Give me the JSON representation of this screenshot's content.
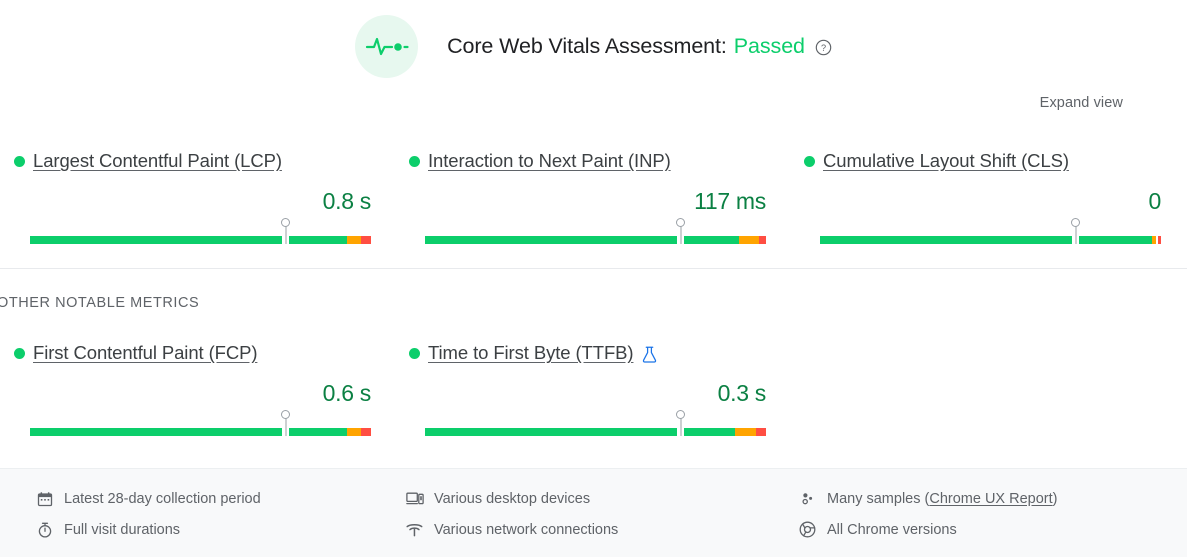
{
  "assessment": {
    "icon": "pulse-icon",
    "label": "Core Web Vitals Assessment:",
    "status": "Passed",
    "status_color": "#0cce6b",
    "help_icon": "help-circle-icon"
  },
  "expand_view": {
    "label": "Expand view"
  },
  "section_label": "OTHER NOTABLE METRICS",
  "colors": {
    "good": "#0cce6b",
    "needs_improvement": "#ffa400",
    "poor": "#ff4e42",
    "value_text": "#0b8043",
    "marker": "#9aa0a6"
  },
  "core_metrics": [
    {
      "name": "Largest Contentful Paint (LCP)",
      "value": "0.8 s",
      "status": "good",
      "marker_percent": 75,
      "distribution": [
        {
          "rating": "good",
          "percent": 74
        },
        {
          "rating": "gap",
          "percent": 2
        },
        {
          "rating": "good",
          "percent": 17
        },
        {
          "rating": "ni",
          "percent": 4
        },
        {
          "rating": "poor",
          "percent": 3
        }
      ]
    },
    {
      "name": "Interaction to Next Paint (INP)",
      "value": "117 ms",
      "status": "good",
      "marker_percent": 75,
      "distribution": [
        {
          "rating": "good",
          "percent": 74
        },
        {
          "rating": "gap",
          "percent": 2
        },
        {
          "rating": "good",
          "percent": 16
        },
        {
          "rating": "ni",
          "percent": 6
        },
        {
          "rating": "poor",
          "percent": 2
        }
      ]
    },
    {
      "name": "Cumulative Layout Shift (CLS)",
      "value": "0",
      "status": "good",
      "marker_percent": 75,
      "distribution": [
        {
          "rating": "good",
          "percent": 74
        },
        {
          "rating": "gap",
          "percent": 2
        },
        {
          "rating": "good",
          "percent": 21.5
        },
        {
          "rating": "ni",
          "percent": 1
        },
        {
          "rating": "gap",
          "percent": 0.5
        },
        {
          "rating": "poor",
          "percent": 1
        }
      ]
    }
  ],
  "other_metrics": [
    {
      "name": "First Contentful Paint (FCP)",
      "value": "0.6 s",
      "status": "good",
      "marker_percent": 75,
      "badge": null,
      "distribution": [
        {
          "rating": "good",
          "percent": 74
        },
        {
          "rating": "gap",
          "percent": 2
        },
        {
          "rating": "good",
          "percent": 17
        },
        {
          "rating": "ni",
          "percent": 4
        },
        {
          "rating": "poor",
          "percent": 3
        }
      ]
    },
    {
      "name": "Time to First Byte (TTFB)",
      "value": "0.3 s",
      "status": "good",
      "marker_percent": 75,
      "badge": "flask-icon",
      "distribution": [
        {
          "rating": "good",
          "percent": 74
        },
        {
          "rating": "gap",
          "percent": 2
        },
        {
          "rating": "good",
          "percent": 15
        },
        {
          "rating": "ni",
          "percent": 6
        },
        {
          "rating": "poor",
          "percent": 3
        }
      ]
    }
  ],
  "footer": {
    "columns": [
      {
        "items": [
          {
            "icon": "calendar-icon",
            "text": "Latest 28-day collection period"
          },
          {
            "icon": "stopwatch-icon",
            "text": "Full visit durations"
          }
        ]
      },
      {
        "items": [
          {
            "icon": "desktop-device-icon",
            "text": "Various desktop devices"
          },
          {
            "icon": "wifi-icon",
            "text": "Various network connections"
          }
        ]
      },
      {
        "items": [
          {
            "icon": "samples-icon",
            "text": "Many samples (",
            "link": "Chrome UX Report",
            "text_after": ")"
          },
          {
            "icon": "chrome-icon",
            "text": "All Chrome versions"
          }
        ]
      }
    ]
  }
}
